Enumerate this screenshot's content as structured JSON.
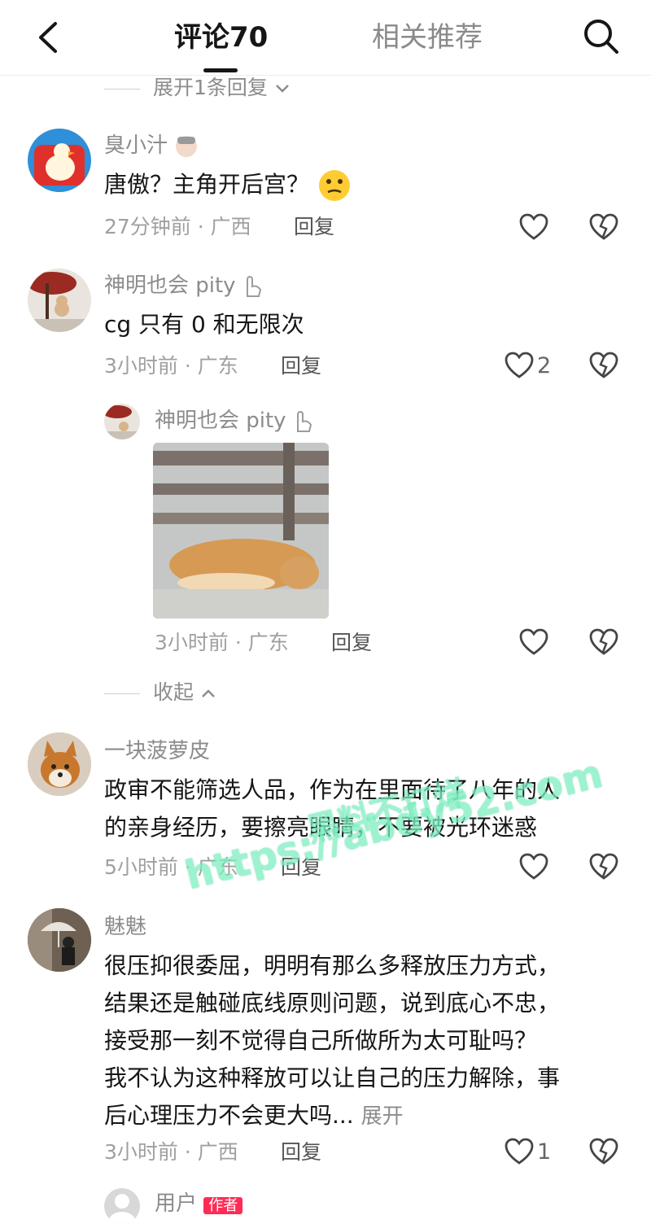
{
  "header": {
    "tab_comments": "评论70",
    "tab_related": "相关推荐",
    "back_icon": "back-arrow-icon",
    "search_icon": "search-icon"
  },
  "top_expand": {
    "label": "展开1条回复"
  },
  "comments": [
    {
      "user": "臭小汁",
      "text": "唐傲？主角开后宫？",
      "emoji": "thinking-face-icon",
      "time_loc": "27分钟前 · 广西",
      "reply_label": "回复",
      "likes": ""
    },
    {
      "user": "神明也会 pity",
      "text": "cg 只有 0 和无限次",
      "time_loc": "3小时前 · 广东",
      "reply_label": "回复",
      "likes": "2",
      "sub_reply": {
        "user": "神明也会 pity",
        "time_loc": "3小时前 · 广东",
        "reply_label": "回复"
      },
      "collapse_label": "收起"
    },
    {
      "user": "一块菠萝皮",
      "text_lines": [
        "政审不能筛选人品，作为在里面待了八年的人",
        "的亲身经历，要擦亮眼睛，不要被光环迷惑"
      ],
      "time_loc": "5小时前 · 广东",
      "reply_label": "回复"
    },
    {
      "user": "魅魅",
      "text_lines": [
        "很压抑很委屈，明明有那么多释放压力方式，",
        "结果还是触碰底线原则问题，说到底心不忠，",
        "接受那一刻不觉得自己所做所为太可耻吗？",
        "我不认为这种释放可以让自己的压力解除，事",
        "后心理压力不会更大吗..."
      ],
      "more_label": "展开",
      "time_loc": "3小时前 · 广西",
      "reply_label": "回复",
      "likes": "1"
    },
    {
      "user": "用户",
      "badge": "作者"
    }
  ],
  "watermark": {
    "line1": "黑料不打烊",
    "line2": "https://abdy52.com"
  },
  "colors": {
    "accent": "#fe2c55",
    "text": "#161616",
    "meta": "#a0a0a0"
  }
}
